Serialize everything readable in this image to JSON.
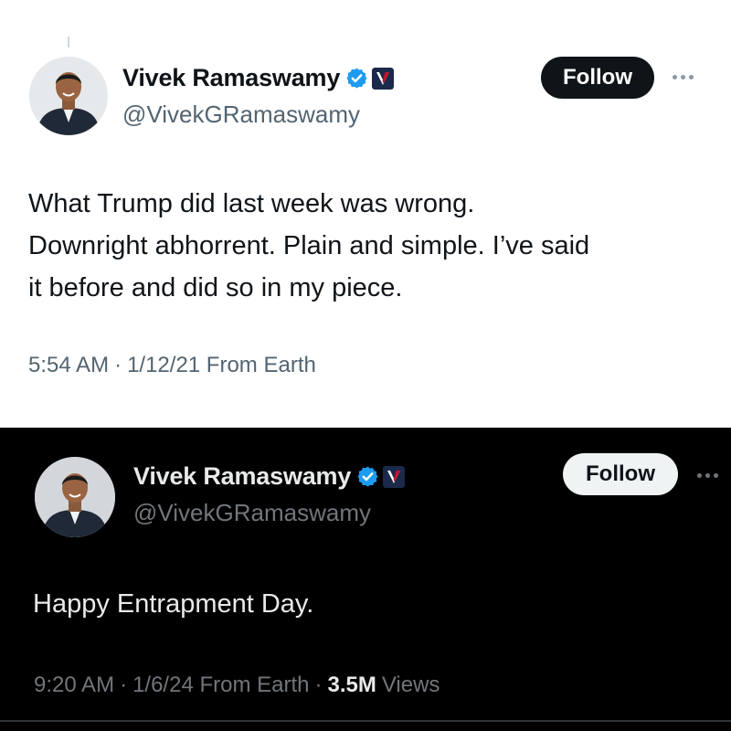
{
  "tweets": [
    {
      "theme": "light",
      "author": {
        "display_name": "Vivek Ramaswamy",
        "handle": "@VivekGRamaswamy",
        "avatar_icon": "profile-photo",
        "verified_icon": "verified-badge-icon",
        "affiliation_icon": "campaign-v-logo-icon"
      },
      "follow_label": "Follow",
      "more_icon": "more-options-icon",
      "text_lines": [
        "What Trump did last week was wrong.",
        "Downright abhorrent. Plain and simple. I’ve said",
        "it before and did so in my piece."
      ],
      "time": "5:54 AM",
      "separator": "·",
      "date_source": "1/12/21 From Earth"
    },
    {
      "theme": "dark",
      "author": {
        "display_name": "Vivek Ramaswamy",
        "handle": "@VivekGRamaswamy",
        "avatar_icon": "profile-photo",
        "verified_icon": "verified-badge-icon",
        "affiliation_icon": "campaign-v-logo-icon"
      },
      "follow_label": "Follow",
      "more_icon": "more-options-icon",
      "text_lines": [
        "Happy Entrapment Day."
      ],
      "time": "9:20 AM",
      "separator": "·",
      "date_source": "1/6/24 From Earth",
      "views_count": "3.5M",
      "views_label": "Views"
    }
  ],
  "colors": {
    "verified_blue": "#1d9bf0",
    "affiliation_navy": "#1b2a4a",
    "affiliation_red": "#c8102e"
  }
}
